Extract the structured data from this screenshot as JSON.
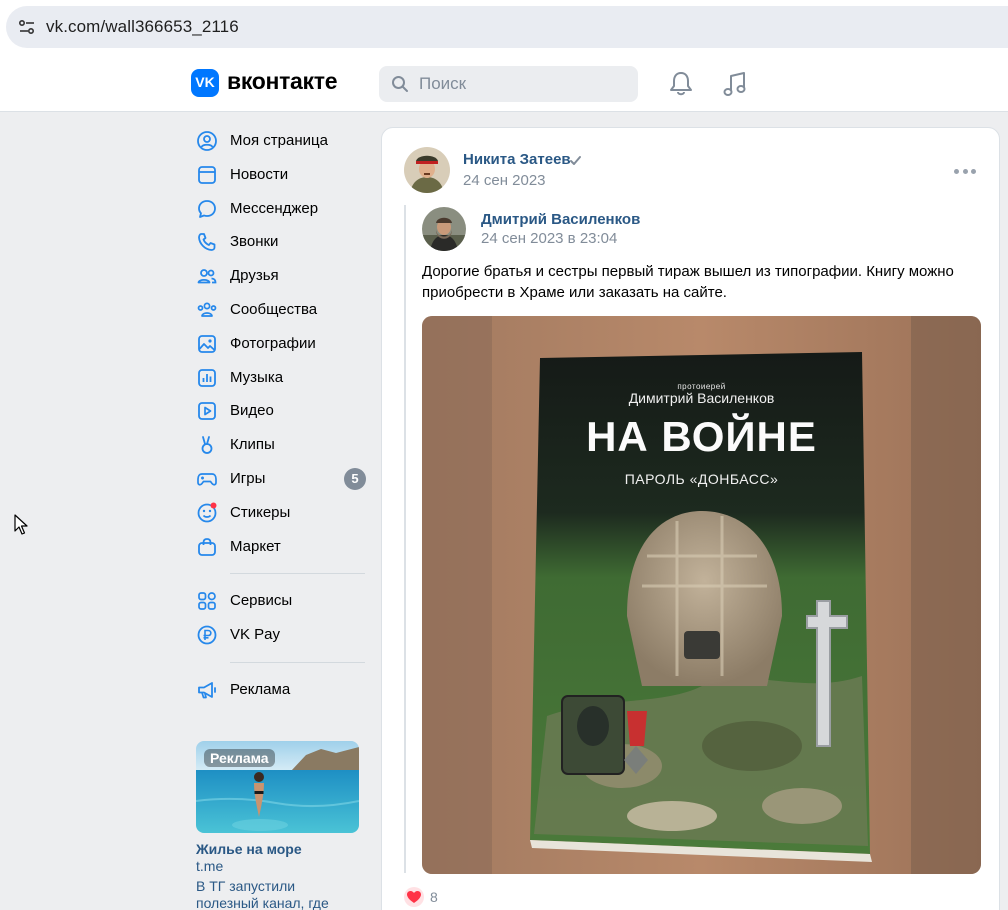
{
  "browser": {
    "url": "vk.com/wall366653_2116"
  },
  "header": {
    "logo_letters": "VK",
    "brand": "вконтакте",
    "search_placeholder": "Поиск"
  },
  "sidebar": {
    "items": [
      {
        "label": "Моя страница",
        "icon": "user-circle-icon"
      },
      {
        "label": "Новости",
        "icon": "news-icon"
      },
      {
        "label": "Мессенджер",
        "icon": "message-icon"
      },
      {
        "label": "Звонки",
        "icon": "phone-icon"
      },
      {
        "label": "Друзья",
        "icon": "friends-icon"
      },
      {
        "label": "Сообщества",
        "icon": "communities-icon"
      },
      {
        "label": "Фотографии",
        "icon": "photo-icon"
      },
      {
        "label": "Музыка",
        "icon": "music-icon"
      },
      {
        "label": "Видео",
        "icon": "video-icon"
      },
      {
        "label": "Клипы",
        "icon": "clips-icon"
      },
      {
        "label": "Игры",
        "icon": "games-icon",
        "badge": "5"
      },
      {
        "label": "Стикеры",
        "icon": "stickers-icon"
      },
      {
        "label": "Маркет",
        "icon": "market-icon"
      }
    ],
    "extra_items": [
      {
        "label": "Сервисы",
        "icon": "services-icon"
      },
      {
        "label": "VK Pay",
        "icon": "vkpay-icon"
      }
    ],
    "ads_item": {
      "label": "Реклама",
      "icon": "megaphone-icon"
    }
  },
  "ad": {
    "tag": "Реклама",
    "title": "Жилье на море",
    "domain": "t.me",
    "description": "В ТГ запустили полезный канал, где"
  },
  "post": {
    "author": "Никита Затеев",
    "date": "24 сен 2023",
    "repost": {
      "author": "Дмитрий Василенков",
      "date": "24 сен 2023 в 23:04",
      "text": "Дорогие братья и сестры первый тираж вышел из типографии. Книгу можно приобрести в Храме или заказать на сайте.",
      "photo": {
        "book_over_title": "протоиерей",
        "book_author": "Димитрий Василенков",
        "book_title": "НА ВОЙНЕ",
        "book_subtitle": "ПАРОЛЬ «ДОНБАСС»"
      }
    },
    "likes": "8"
  },
  "colors": {
    "vk_blue": "#0077ff",
    "link": "#2a5885",
    "muted": "#818c99",
    "background": "#edeef0",
    "like_red": "#ff3347"
  }
}
